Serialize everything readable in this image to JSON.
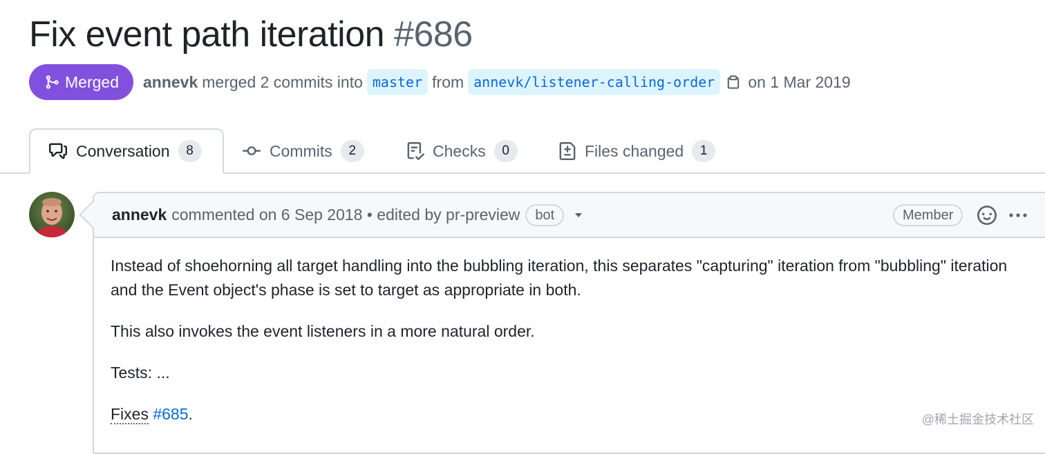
{
  "pr": {
    "title": "Fix event path iteration",
    "number": "#686",
    "state": "Merged",
    "author": "annevk",
    "merge_text": "merged 2 commits into",
    "base_branch": "master",
    "from_text": "from",
    "head_branch": "annevk/listener-calling-order",
    "date_text": "on 1 Mar 2019"
  },
  "tabs": [
    {
      "label": "Conversation",
      "count": "8",
      "icon": "comment-discussion-icon",
      "selected": true
    },
    {
      "label": "Commits",
      "count": "2",
      "icon": "git-commit-icon",
      "selected": false
    },
    {
      "label": "Checks",
      "count": "0",
      "icon": "checklist-icon",
      "selected": false
    },
    {
      "label": "Files changed",
      "count": "1",
      "icon": "file-diff-icon",
      "selected": false
    }
  ],
  "comment": {
    "author": "annevk",
    "meta": "commented on 6 Sep 2018 • edited by pr-preview",
    "bot_label": "bot",
    "role_label": "Member",
    "body": {
      "p1": "Instead of shoehorning all target handling into the bubbling iteration, this separates \"capturing\" iteration from \"bubbling\" iteration and the Event object's phase is set to target as appropriate in both.",
      "p2": "This also invokes the event listeners in a more natural order.",
      "p3": "Tests: ...",
      "fixes_word": "Fixes",
      "fixes_link": "#685",
      "fixes_end": "."
    }
  },
  "colors": {
    "merged": "#8250df",
    "link": "#0969da",
    "branch_bg": "#ddf4ff",
    "border": "#d1d9e0"
  },
  "watermark": "@稀土掘金技术社区"
}
